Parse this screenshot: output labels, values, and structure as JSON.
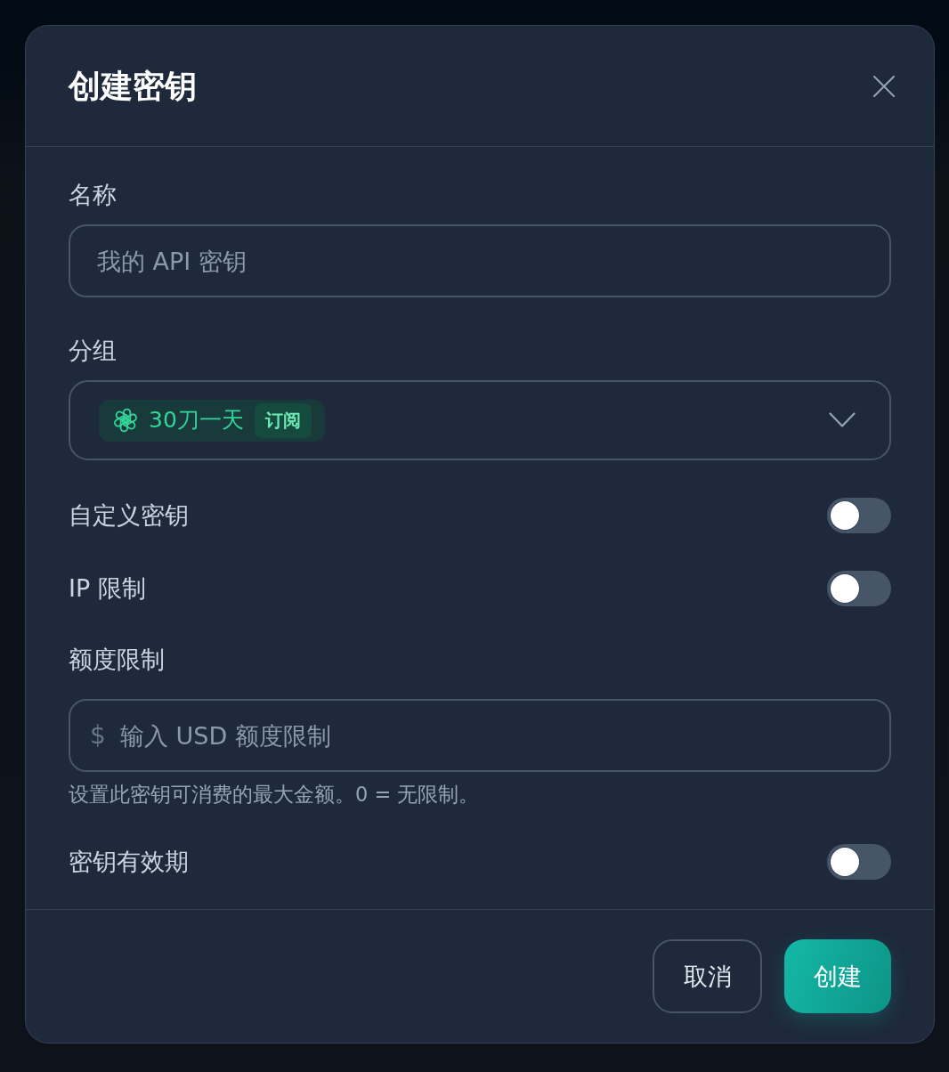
{
  "dialog": {
    "title": "创建密钥"
  },
  "fields": [
    {
      "kind": "text",
      "label": "名称",
      "placeholder": "我的 API 密钥"
    },
    {
      "kind": "select",
      "label": "分组",
      "value": {
        "name": "30刀一天",
        "badge": "订阅"
      }
    },
    {
      "kind": "toggle",
      "label": "自定义密钥",
      "on": false
    },
    {
      "kind": "toggle",
      "label": "IP 限制",
      "on": false
    },
    {
      "kind": "money",
      "label": "额度限制",
      "prefix": "$",
      "placeholder": "输入 USD 额度限制",
      "help": "设置此密钥可消费的最大金额。0 = 无限制。"
    },
    {
      "kind": "toggle",
      "label": "密钥有效期",
      "on": false
    }
  ],
  "buttons": [
    {
      "kind": "secondary",
      "label": "取消"
    },
    {
      "kind": "primary",
      "label": "创建"
    }
  ]
}
